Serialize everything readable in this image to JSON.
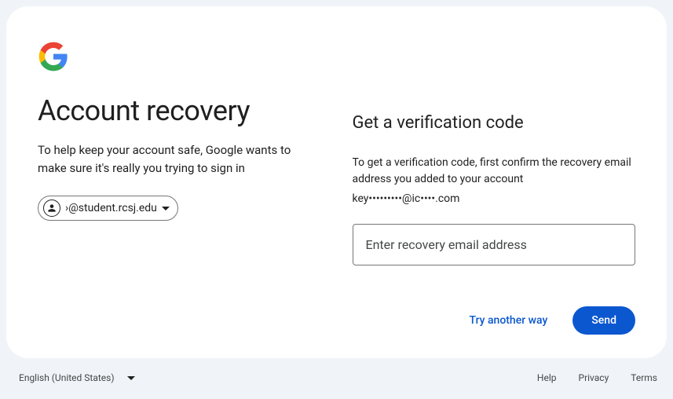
{
  "header": {
    "title": "Account recovery",
    "subtitle": "To help keep your account safe, Google wants to make sure it's really you trying to sign in"
  },
  "account_chip": {
    "email": "›@student.rcsj.edu"
  },
  "verify": {
    "heading": "Get a verification code",
    "description": "To get a verification code, first confirm the recovery email address you added to your account",
    "masked_email": "key•••••••••@ic••••.com",
    "input_placeholder": "Enter recovery email address"
  },
  "actions": {
    "try_another": "Try another way",
    "send": "Send"
  },
  "footer": {
    "language": "English (United States)",
    "help": "Help",
    "privacy": "Privacy",
    "terms": "Terms"
  }
}
